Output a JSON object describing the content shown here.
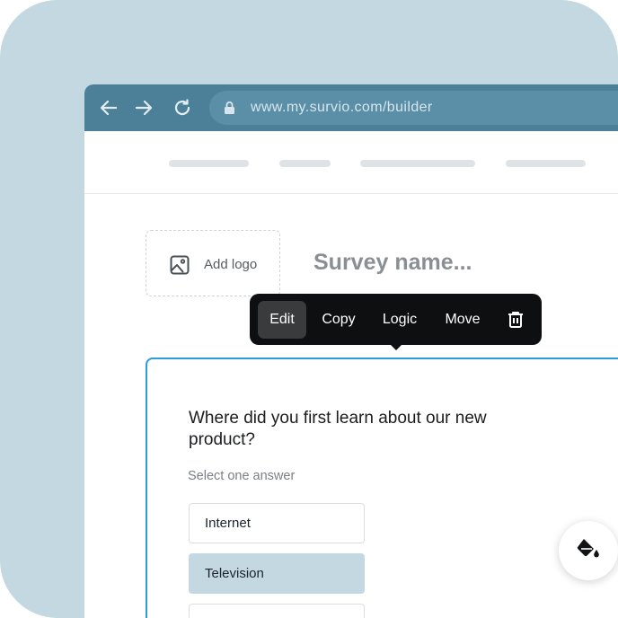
{
  "browser": {
    "url": "www.my.survio.com/builder",
    "icons": [
      "back-arrow-icon",
      "forward-arrow-icon",
      "reload-icon",
      "lock-icon"
    ]
  },
  "header": {
    "logo_label": "Add logo",
    "survey_name_placeholder": "Survey name..."
  },
  "toolbar": {
    "edit": "Edit",
    "copy": "Copy",
    "logic": "Logic",
    "move": "Move"
  },
  "question": {
    "text": "Where did you first learn about our new product?",
    "hint": "Select one answer",
    "options": [
      {
        "label": "Internet",
        "selected": false
      },
      {
        "label": "Television",
        "selected": true
      },
      {
        "label": "",
        "selected": false
      }
    ]
  },
  "colors": {
    "frame": "#c3d8e1",
    "titlebar": "#4c8099",
    "accent_border": "#2f9cd7",
    "toolbar_bg": "#0e0f10"
  }
}
